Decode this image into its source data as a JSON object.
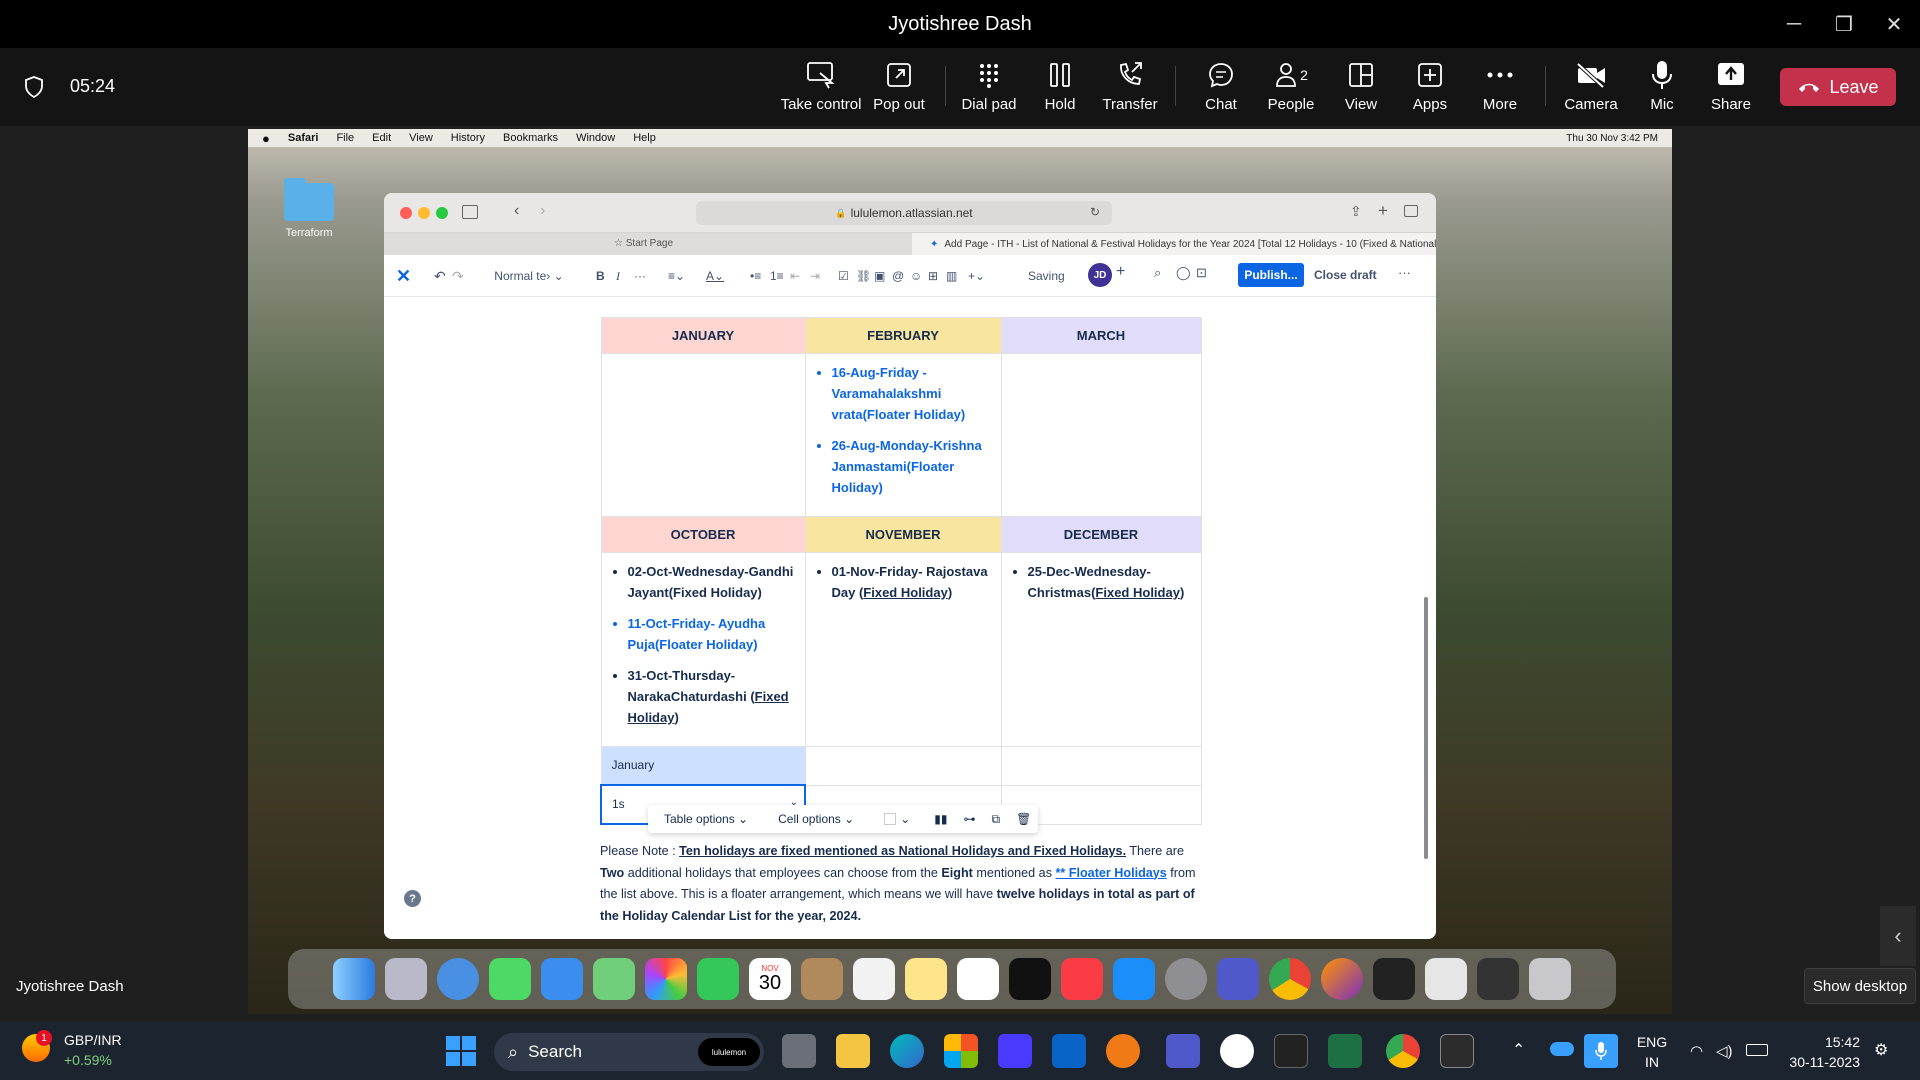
{
  "window": {
    "title": "Jyotishree Dash",
    "minimize": "─",
    "restore": "❐",
    "close": "✕"
  },
  "call": {
    "timer": "05:24",
    "participant_name": "Jyotishree Dash",
    "people_count": "2"
  },
  "toolbar": {
    "take_control": "Take control",
    "pop_out": "Pop out",
    "dial_pad": "Dial pad",
    "hold": "Hold",
    "transfer": "Transfer",
    "chat": "Chat",
    "people": "People",
    "view": "View",
    "apps": "Apps",
    "more": "More",
    "camera": "Camera",
    "mic": "Mic",
    "share": "Share",
    "leave": "Leave"
  },
  "mac_menu": {
    "app": "Safari",
    "file": "File",
    "edit": "Edit",
    "view": "View",
    "history": "History",
    "bookmarks": "Bookmarks",
    "window": "Window",
    "help": "Help",
    "datetime": "Thu 30 Nov  3:42 PM"
  },
  "desktop": {
    "folder_label": "Terraform"
  },
  "browser": {
    "url": "lululemon.atlassian.net",
    "tab1": "Start Page",
    "tab2": "Add Page - ITH - List of National & Festival Holidays for the Year 2024 [Total 12 Holidays - 10 (Fixed & National) +..."
  },
  "editor": {
    "text_style": "Normal te› ⌄",
    "saving": "Saving",
    "avatar": "JD",
    "publish": "Publish...",
    "close_draft": "Close draft",
    "table": {
      "headers1": [
        "JANUARY",
        "FEBRUARY",
        "MARCH"
      ],
      "feb_items": [
        {
          "text": "16-Aug-Friday - Varamahalakshmi vrata(Floater Holiday)"
        },
        {
          "text": "26-Aug-Monday-Krishna Janmastami(Floater Holiday)"
        }
      ],
      "headers2": [
        "OCTOBER",
        "NOVEMBER",
        "DECEMBER"
      ],
      "oct_items": [
        {
          "a": "02-Oct-Wednesday-Gandhi Jayant(Fixed Holiday)"
        },
        {
          "a": "11-Oct-Friday- Ayudha Puja(Floater Holiday)"
        },
        {
          "a": "31-Oct-Thursday-NarakaChaturdashi (",
          "b": "Fixed Holiday",
          "c": ")"
        }
      ],
      "nov_item": {
        "a": "01-Nov-Friday- Rajostava Day (",
        "b": "Fixed Holiday",
        "c": ")"
      },
      "dec_item": {
        "a": "25-Dec-Wednesday-Christmas(",
        "b": "Fixed Holiday",
        "c": ")"
      },
      "new_row_label": "January",
      "typing_cell": "1s"
    },
    "table_options": "Table options",
    "cell_options": "Cell options",
    "note": {
      "p1": "Please Note : ",
      "p2": "Ten holidays are fixed mentioned as National Holidays and Fixed Holidays.",
      "p3": " There are ",
      "p4": "Two",
      "p5": " additional holidays that employees can choose from the ",
      "p6": "Eight",
      "p7": " mentioned as ",
      "p8": "** Floater Holidays",
      "p9": " from the list above. This is a floater arrangement, which means we will have ",
      "p10": "twelve holidays in total as part of the Holiday Calendar List for the year, 2024."
    }
  },
  "dock": {
    "calendar_month": "NOV",
    "calendar_day": "30"
  },
  "show_desktop": "Show desktop",
  "taskbar": {
    "stock_name": "GBP/INR",
    "stock_change": "+0.59%",
    "stock_badge": "1",
    "search": "Search",
    "search_badge": "lululemon",
    "lang1": "ENG",
    "lang2": "IN",
    "time": "15:42",
    "date": "30-11-2023"
  },
  "colors": {
    "accent": "#0c66e4",
    "leave": "#c4314b",
    "jan_header": "#ffd5d2",
    "feb_header": "#f8e6a0",
    "mar_header": "#e1dcf9",
    "new_row": "#cce0ff"
  }
}
